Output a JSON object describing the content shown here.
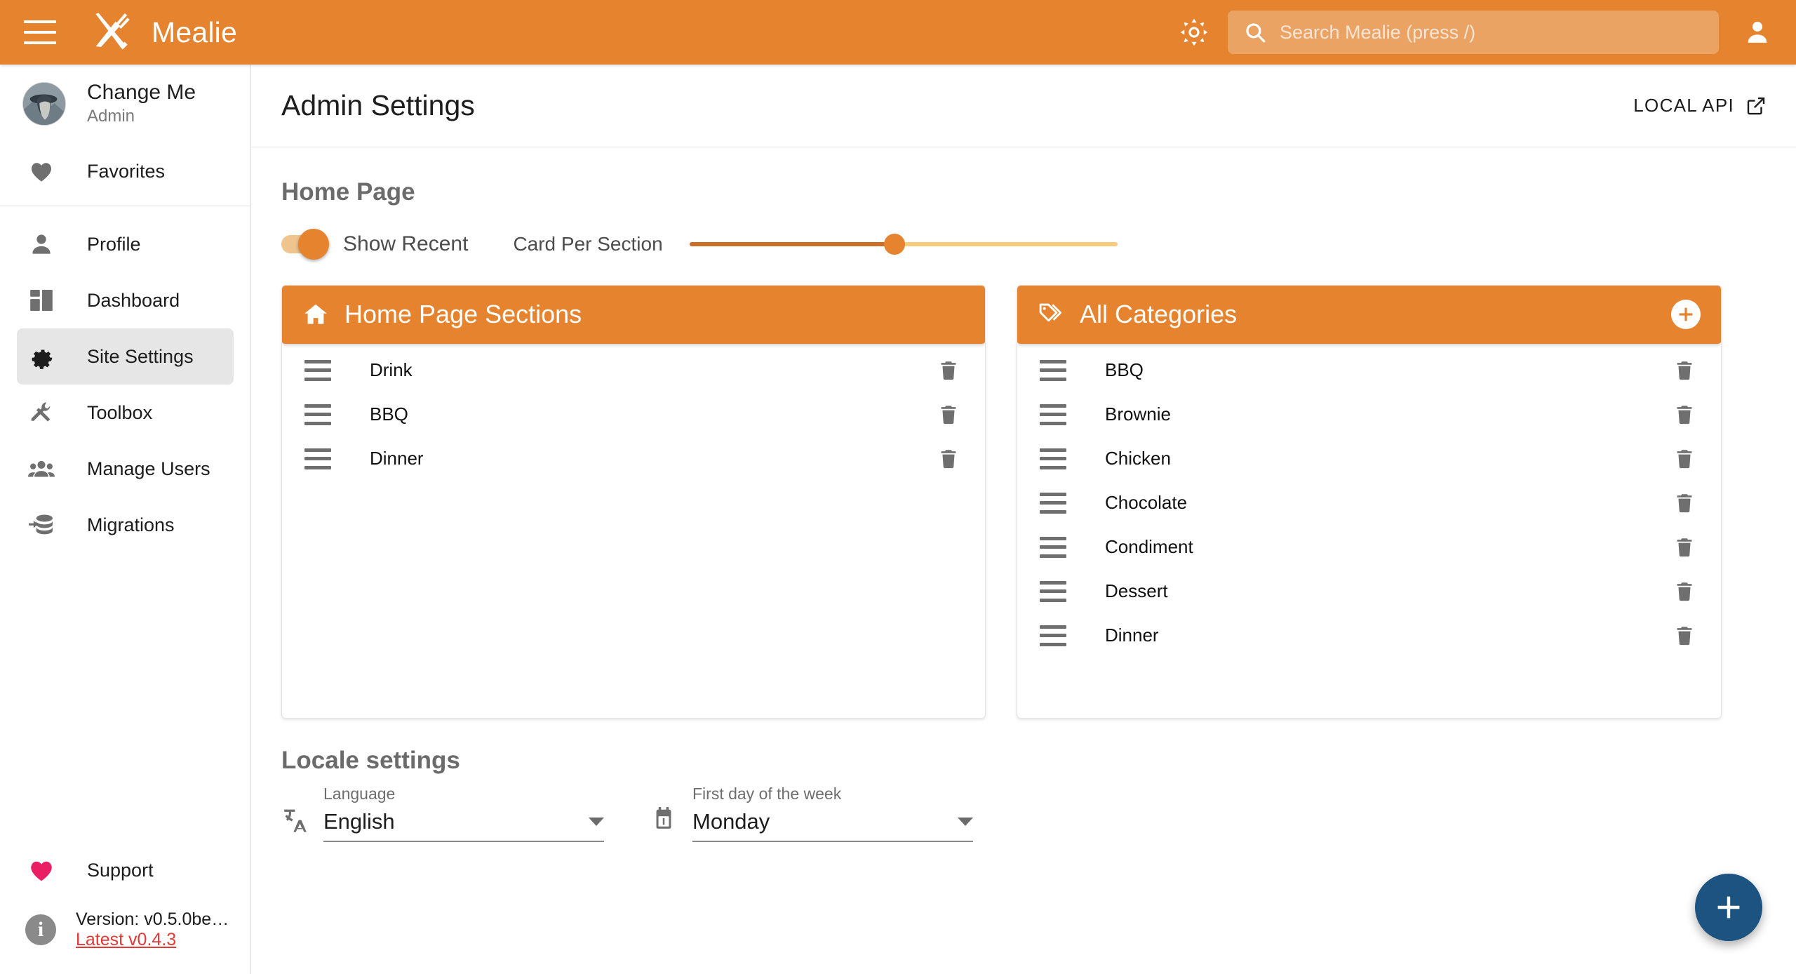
{
  "appbar": {
    "menu_icon": "hamburger-menu-icon",
    "logo_icon": "mealie-fork-knife-logo",
    "title": "Mealie",
    "theme_icon": "brightness-theme-icon",
    "search": {
      "icon": "search-icon",
      "value": "",
      "placeholder": "Search Mealie (press /)"
    },
    "account_icon": "account-icon",
    "accent_color": "#E5832F"
  },
  "sidebar": {
    "user": {
      "name": "Change Me",
      "role": "Admin",
      "avatar_icon": "user-avatar"
    },
    "items": [
      {
        "label": "Favorites",
        "icon": "heart-icon",
        "active": false
      },
      {
        "label": "Profile",
        "icon": "account-icon",
        "active": false
      },
      {
        "label": "Dashboard",
        "icon": "dashboard-grid-icon",
        "active": false
      },
      {
        "label": "Site Settings",
        "icon": "gear-icon",
        "active": true
      },
      {
        "label": "Toolbox",
        "icon": "tools-icon",
        "active": false
      },
      {
        "label": "Manage Users",
        "icon": "people-group-icon",
        "active": false
      },
      {
        "label": "Migrations",
        "icon": "database-import-icon",
        "active": false
      }
    ],
    "support": {
      "label": "Support",
      "icon": "heart-filled-icon",
      "color": "#E91E63"
    },
    "version": {
      "icon": "info-icon",
      "current": "Version: v0.5.0be…",
      "latest": "Latest v0.4.3",
      "latest_color": "#e53935"
    }
  },
  "page": {
    "title": "Admin Settings",
    "local_api": {
      "label": "LOCAL API",
      "icon": "open-in-new-icon"
    }
  },
  "home_page": {
    "heading": "Home Page",
    "show_recent": {
      "label": "Show Recent",
      "enabled": true
    },
    "card_per_section": {
      "label": "Card Per Section",
      "percent": 48
    }
  },
  "sections_card": {
    "icon": "home-icon",
    "title": "Home Page Sections",
    "rows": [
      {
        "label": "Drink",
        "handle_icon": "drag-handle-icon",
        "delete_icon": "trash-icon"
      },
      {
        "label": "BBQ",
        "handle_icon": "drag-handle-icon",
        "delete_icon": "trash-icon"
      },
      {
        "label": "Dinner",
        "handle_icon": "drag-handle-icon",
        "delete_icon": "trash-icon"
      }
    ]
  },
  "categories_card": {
    "icon": "tag-icon",
    "title": "All Categories",
    "add_icon": "plus-icon",
    "rows": [
      {
        "label": "BBQ",
        "handle_icon": "drag-handle-icon",
        "delete_icon": "trash-icon"
      },
      {
        "label": "Brownie",
        "handle_icon": "drag-handle-icon",
        "delete_icon": "trash-icon"
      },
      {
        "label": "Chicken",
        "handle_icon": "drag-handle-icon",
        "delete_icon": "trash-icon"
      },
      {
        "label": "Chocolate",
        "handle_icon": "drag-handle-icon",
        "delete_icon": "trash-icon"
      },
      {
        "label": "Condiment",
        "handle_icon": "drag-handle-icon",
        "delete_icon": "trash-icon"
      },
      {
        "label": "Dessert",
        "handle_icon": "drag-handle-icon",
        "delete_icon": "trash-icon"
      },
      {
        "label": "Dinner",
        "handle_icon": "drag-handle-icon",
        "delete_icon": "trash-icon"
      }
    ]
  },
  "locale": {
    "heading": "Locale settings",
    "language": {
      "icon": "translate-icon",
      "label": "Language",
      "value": "English"
    },
    "first_day": {
      "icon": "calendar-icon",
      "label": "First day of the week",
      "value": "Monday"
    }
  },
  "fab": {
    "icon": "plus-icon",
    "color": "#1c5380"
  }
}
